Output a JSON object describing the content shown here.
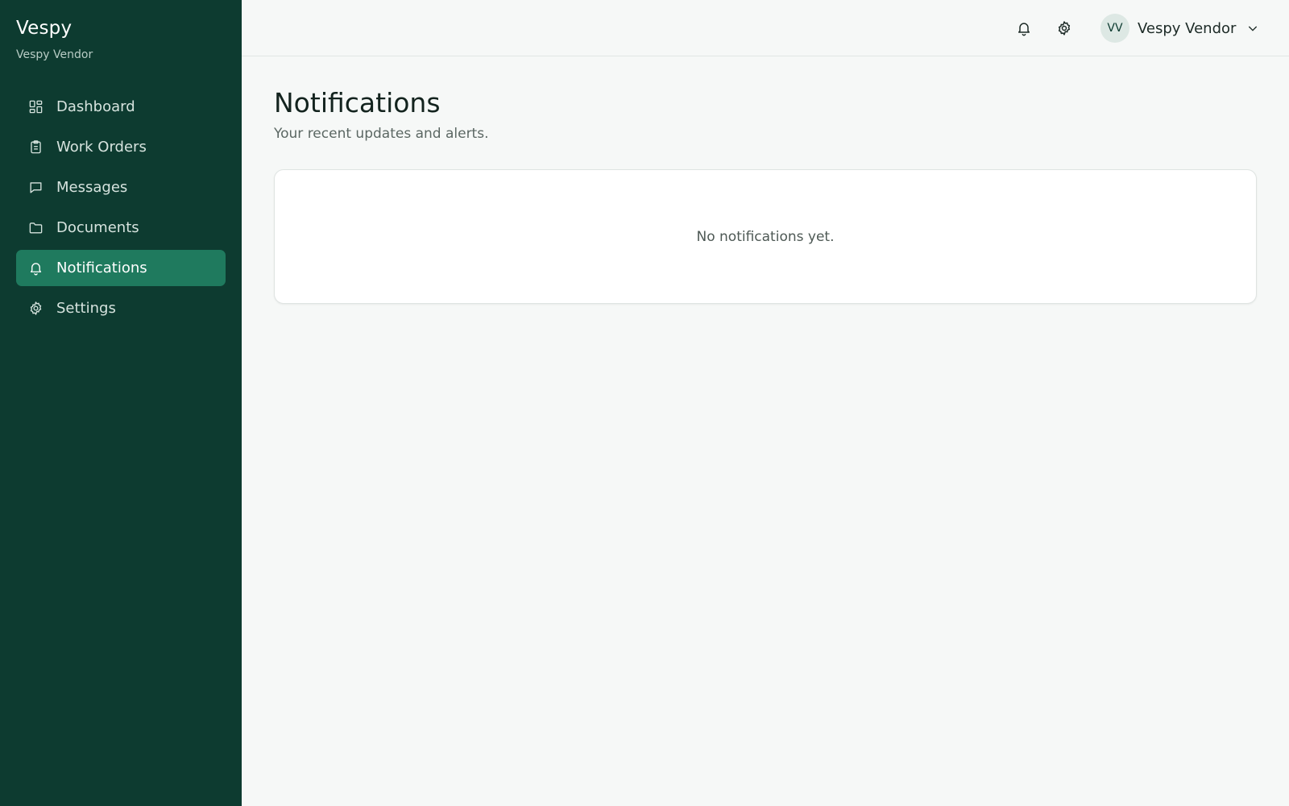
{
  "app": {
    "brand": "Vespy",
    "org": "Vespy Vendor"
  },
  "sidebar": {
    "items": [
      {
        "label": "Dashboard",
        "icon": "dashboard-icon",
        "active": false
      },
      {
        "label": "Work Orders",
        "icon": "clipboard-icon",
        "active": false
      },
      {
        "label": "Messages",
        "icon": "message-icon",
        "active": false
      },
      {
        "label": "Documents",
        "icon": "folder-icon",
        "active": false
      },
      {
        "label": "Notifications",
        "icon": "bell-icon",
        "active": true
      },
      {
        "label": "Settings",
        "icon": "gear-icon",
        "active": false
      }
    ]
  },
  "header": {
    "icons": [
      "bell-icon",
      "gear-icon"
    ],
    "user": {
      "initials": "VV",
      "name": "Vespy Vendor",
      "menu_icon": "chevron-down-icon"
    }
  },
  "main": {
    "title": "Notifications",
    "subtitle": "Your recent updates and alerts.",
    "empty_message": "No notifications yet."
  },
  "colors": {
    "sidebar_bg": "#0d3b30",
    "active_item_bg": "#1f7a5e",
    "page_bg": "#f6f8f7",
    "card_bg": "#ffffff"
  }
}
